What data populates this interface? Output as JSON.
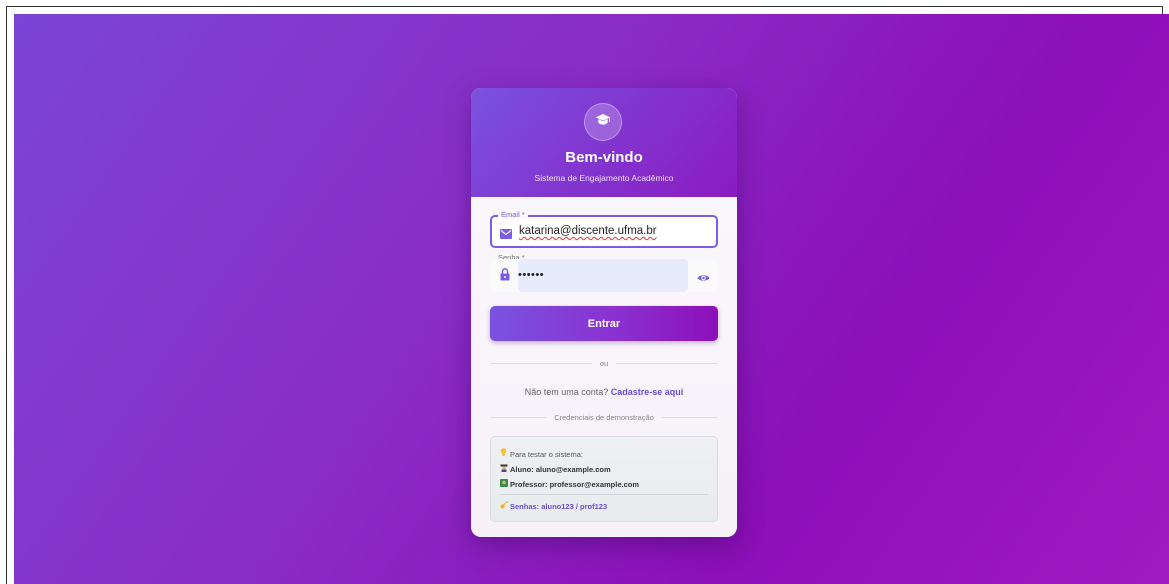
{
  "header": {
    "title": "Bem-vindo",
    "subtitle": "Sistema de Engajamento Acadêmico",
    "logo_icon": "graduation-cap-icon"
  },
  "form": {
    "email_label": "Email *",
    "email_value": "katarina@discente.ufma.br",
    "password_label": "Senha *",
    "password_value": "••••••",
    "submit_label": "Entrar",
    "divider_text": "ou"
  },
  "signup": {
    "prompt": "Não tem uma conta?",
    "link": "Cadastre-se aqui"
  },
  "demo": {
    "divider_text": "Credenciais de demonstração",
    "title": "Para testar o sistema:",
    "aluno": "Aluno: aluno@example.com",
    "professor": "Professor: professor@example.com",
    "senhas": "Senhas: aluno123 / prof123"
  },
  "colors": {
    "accent": "#7c5ce6",
    "background_start": "#7b45d6",
    "background_end": "#a11ac4"
  }
}
